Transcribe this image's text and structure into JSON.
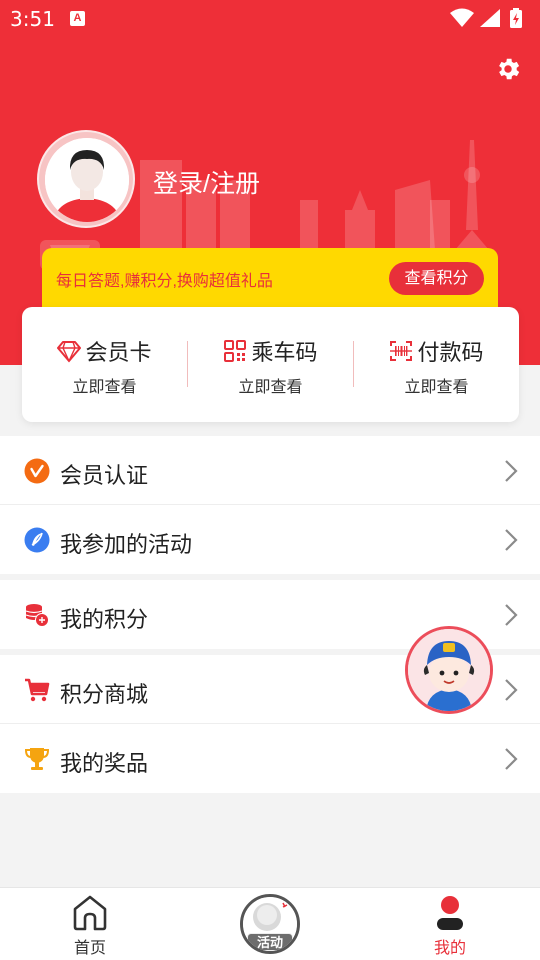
{
  "status_bar": {
    "time": "3:51",
    "app_badge": "A"
  },
  "profile": {
    "login_label": "登录/注册"
  },
  "quiz_banner": {
    "text": "每日答题,赚积分,换购超值礼品",
    "button": "查看积分"
  },
  "quick_cards": [
    {
      "icon": "diamond-icon",
      "title": "会员卡",
      "subtitle": "立即查看"
    },
    {
      "icon": "qr-code-icon",
      "title": "乘车码",
      "subtitle": "立即查看"
    },
    {
      "icon": "barcode-scan-icon",
      "title": "付款码",
      "subtitle": "立即查看"
    }
  ],
  "menu_groups": [
    [
      {
        "icon": "verified-badge-icon",
        "label": "会员认证"
      },
      {
        "icon": "compass-icon",
        "label": "我参加的活动"
      }
    ],
    [
      {
        "icon": "coin-stack-icon",
        "label": "我的积分"
      }
    ],
    [
      {
        "icon": "shopping-cart-icon",
        "label": "积分商城"
      },
      {
        "icon": "trophy-icon",
        "label": "我的奖品"
      }
    ]
  ],
  "tabbar": {
    "home": "首页",
    "activity": "活动",
    "mine": "我的"
  },
  "colors": {
    "brand_red": "#ee2f38",
    "banner_yellow": "#ffd900"
  }
}
